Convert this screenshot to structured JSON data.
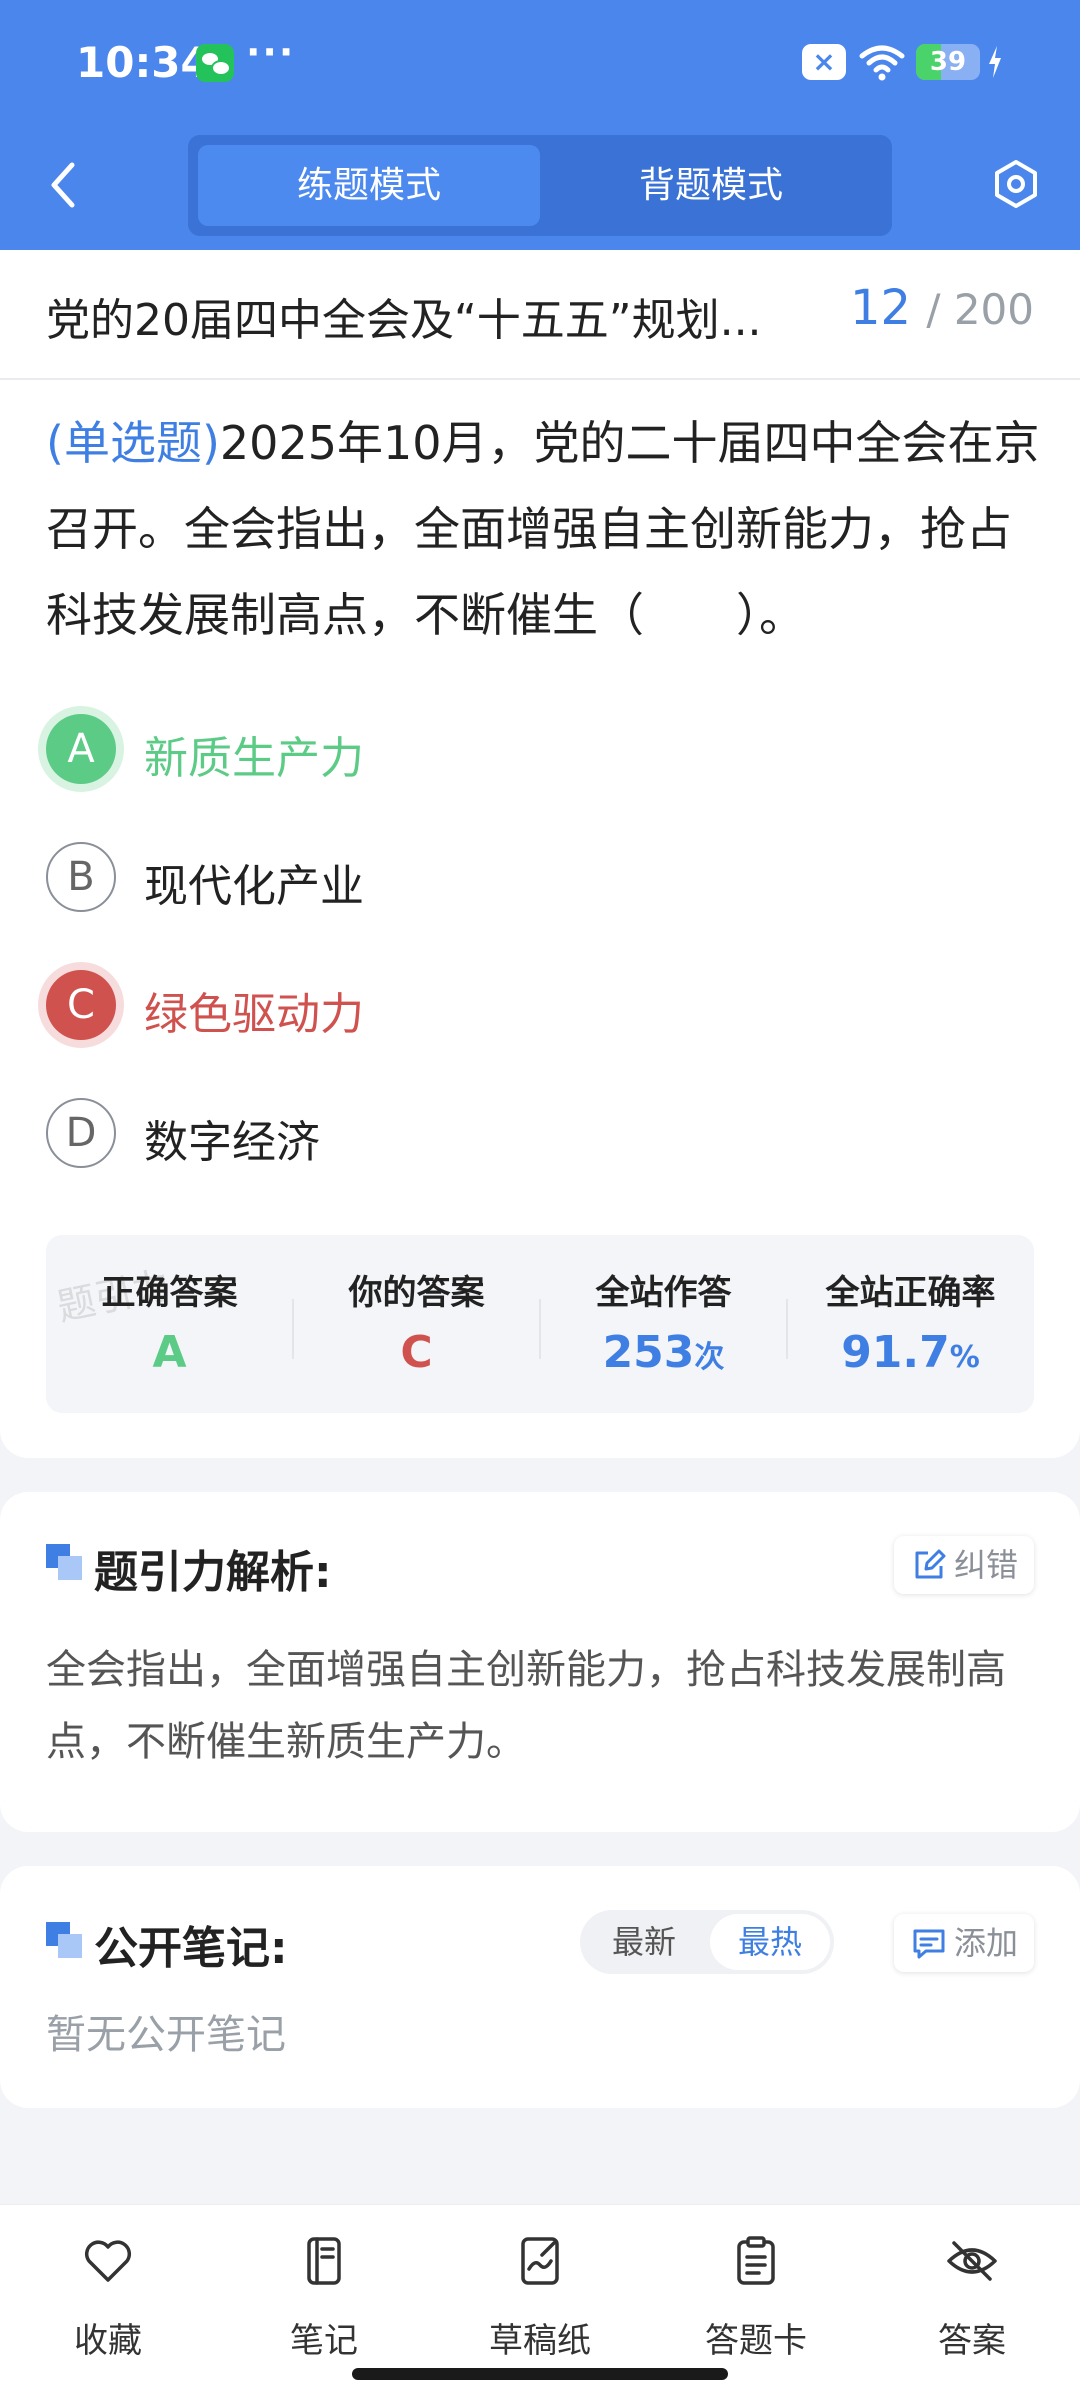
{
  "status_bar": {
    "time": "10:34",
    "more": "···",
    "x_badge": "×",
    "battery": "39",
    "battery_level": 0.39
  },
  "header": {
    "tabs": [
      "练题模式",
      "背题模式"
    ],
    "active_tab": 0,
    "colors": {
      "header_bg": "#4a86ec",
      "seg_bg": "#3a72d6"
    }
  },
  "question": {
    "title": "党的20届四中全会及“十五五”规划...",
    "current": "12",
    "total": "/ 200",
    "type": "(单选题)",
    "text": "2025年10月，党的二十届四中全会在京召开。全会指出，全面增强自主创新能力，抢占科技发展制高点，不断催生（　　）。",
    "options": [
      {
        "letter": "A",
        "text": "新质生产力",
        "state": "correct"
      },
      {
        "letter": "B",
        "text": "现代化产业",
        "state": "normal"
      },
      {
        "letter": "C",
        "text": "绿色驱动力",
        "state": "wrong"
      },
      {
        "letter": "D",
        "text": "数字经济",
        "state": "normal"
      }
    ]
  },
  "stats": {
    "watermark": "题引力",
    "items": [
      {
        "label": "正确答案",
        "value": "A",
        "unit": ""
      },
      {
        "label": "你的答案",
        "value": "C",
        "unit": ""
      },
      {
        "label": "全站作答",
        "value": "253",
        "unit": "次"
      },
      {
        "label": "全站正确率",
        "value": "91.7",
        "unit": "%"
      }
    ],
    "colors": {
      "correct": "#5ccb86",
      "wrong": "#d0524f",
      "accent": "#3f7fe3"
    }
  },
  "analysis": {
    "title": "题引力解析:",
    "report_btn": "纠错",
    "text": "全会指出，全面增强自主创新能力，抢占科技发展制高点，不断催生新质生产力。"
  },
  "notes": {
    "title": "公开笔记:",
    "sort": [
      "最新",
      "最热"
    ],
    "active_sort": 1,
    "add_btn": "添加",
    "empty": "暂无公开笔记"
  },
  "bottom_nav": [
    {
      "label": "收藏",
      "icon": "heart-icon"
    },
    {
      "label": "笔记",
      "icon": "notebook-icon"
    },
    {
      "label": "草稿纸",
      "icon": "draft-icon"
    },
    {
      "label": "答题卡",
      "icon": "clipboard-icon"
    },
    {
      "label": "答案",
      "icon": "eye-off-icon"
    }
  ]
}
